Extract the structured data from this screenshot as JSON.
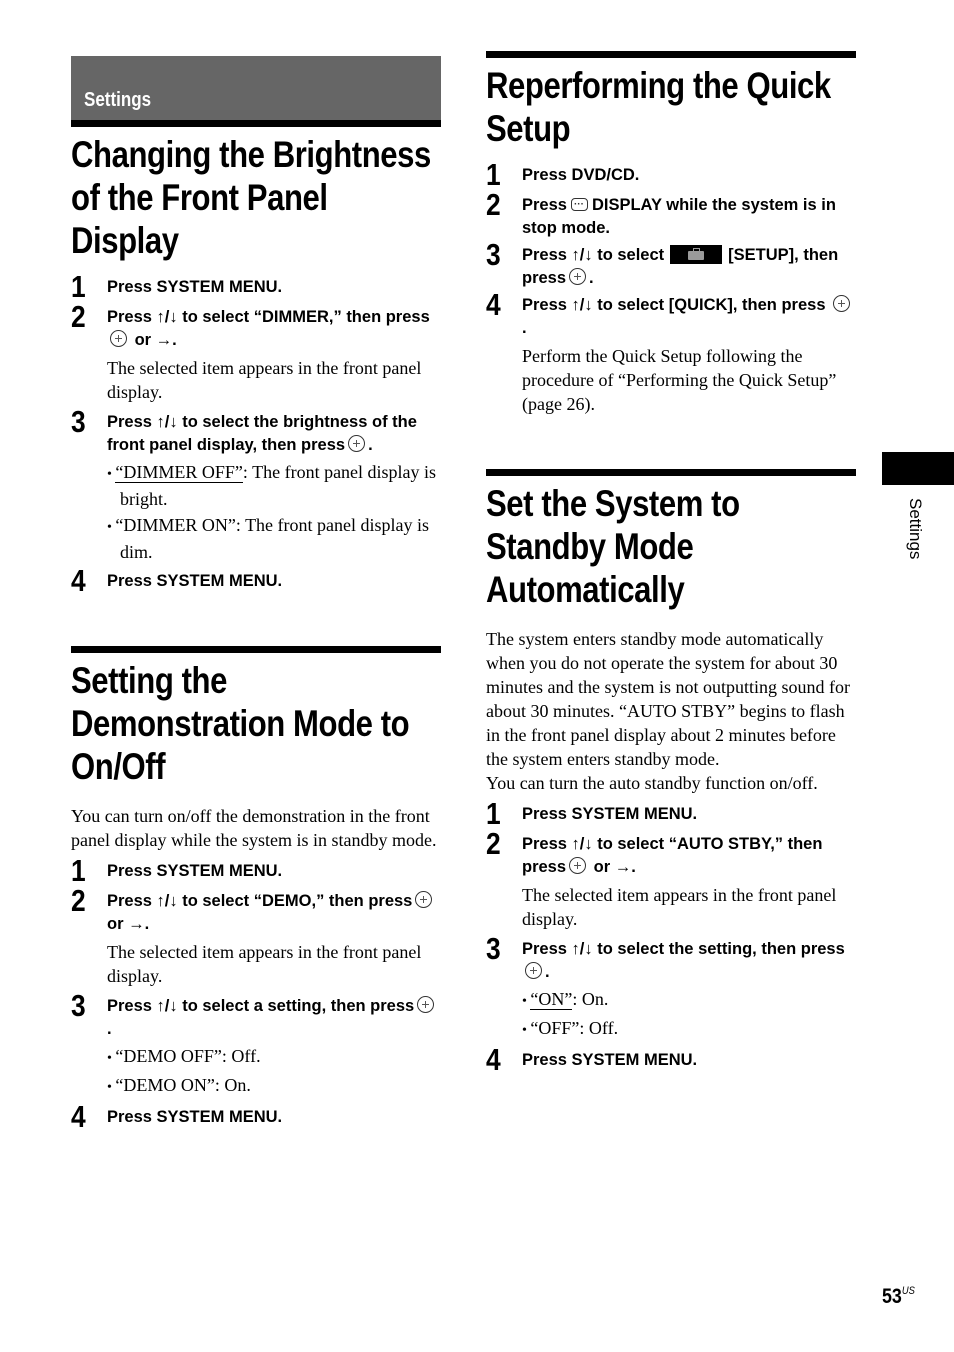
{
  "section_label": "Settings",
  "side_tab_label": "Settings",
  "page_number": "53",
  "page_suffix": "US",
  "left": {
    "brightness": {
      "title": "Changing the Brightness of the Front Panel Display",
      "steps": [
        {
          "num": "1",
          "text": "Press SYSTEM MENU."
        },
        {
          "num": "2",
          "text_a": "Press ↑/↓ to select “DIMMER,” then press",
          "text_b": "or →.",
          "note": "The selected item appears in the front panel display."
        },
        {
          "num": "3",
          "text_a": "Press ↑/↓ to select the brightness of the front panel display, then press",
          "text_b": ".",
          "bullets": [
            {
              "key": "“DIMMER OFF”",
              "desc": ": The front panel display is bright."
            },
            {
              "key": "“DIMMER ON”",
              "desc": ": The front panel display is dim."
            }
          ]
        },
        {
          "num": "4",
          "text": "Press SYSTEM MENU."
        }
      ]
    },
    "demo": {
      "title": "Setting the Demonstration Mode to On/Off",
      "intro": "You can turn on/off the demonstration in the front panel display while the system is in standby mode.",
      "steps": [
        {
          "num": "1",
          "text": "Press SYSTEM MENU."
        },
        {
          "num": "2",
          "text_a": "Press ↑/↓ to select “DEMO,” then press",
          "text_b": "or →.",
          "note": "The selected item appears in the front panel display."
        },
        {
          "num": "3",
          "text_a": "Press ↑/↓ to select a setting, then press",
          "text_b": ".",
          "bullets": [
            {
              "key": "“DEMO OFF”",
              "desc": ": Off."
            },
            {
              "key": "“DEMO ON”",
              "desc": ": On."
            }
          ]
        },
        {
          "num": "4",
          "text": "Press SYSTEM MENU."
        }
      ]
    }
  },
  "right": {
    "quick": {
      "title": "Reperforming the Quick Setup",
      "steps": [
        {
          "num": "1",
          "text": "Press DVD/CD."
        },
        {
          "num": "2",
          "text_a": "Press",
          "text_b": "DISPLAY while the system is in stop mode."
        },
        {
          "num": "3",
          "text_a": "Press ↑/↓ to select",
          "text_b": "[SETUP], then press",
          "text_c": "."
        },
        {
          "num": "4",
          "text_a": "Press ↑/↓ to select [QUICK], then press",
          "text_b": ".",
          "note": "Perform the Quick Setup following the procedure of “Performing the Quick Setup” (page 26)."
        }
      ]
    },
    "standby": {
      "title": "Set the System to Standby Mode Automatically",
      "intro_1": "The system enters standby mode automatically when you do not operate the system for about 30 minutes and the system is not outputting sound for about 30 minutes. “AUTO STBY” begins to flash in the front panel display about 2 minutes before the system enters standby mode.",
      "intro_2": "You can turn the auto standby function on/off.",
      "steps": [
        {
          "num": "1",
          "text": "Press SYSTEM MENU."
        },
        {
          "num": "2",
          "text_a": "Press ↑/↓ to select “AUTO STBY,” then press",
          "text_b": "or →.",
          "note": "The selected item appears in the front panel display."
        },
        {
          "num": "3",
          "text_a": "Press ↑/↓ to select the setting, then press",
          "text_b": ".",
          "bullets": [
            {
              "key": "“ON”",
              "desc": ": On."
            },
            {
              "key": "“OFF”",
              "desc": ": Off."
            }
          ]
        },
        {
          "num": "4",
          "text": "Press SYSTEM MENU."
        }
      ]
    }
  }
}
